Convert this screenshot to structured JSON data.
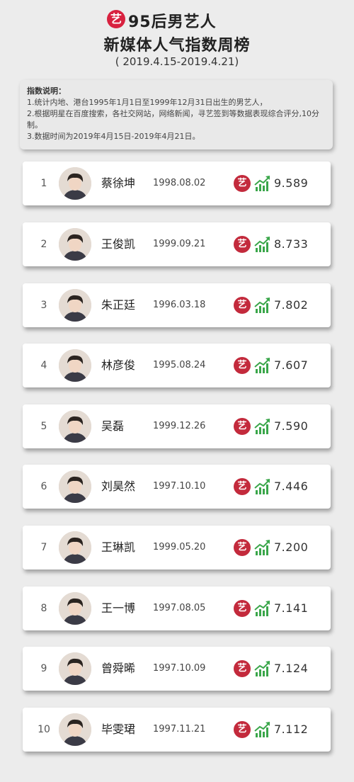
{
  "header": {
    "brand_badge": "艺",
    "title_line1": "95后男艺人",
    "title_line2": "新媒体人气指数周榜",
    "date_range": "( 2019.4.15-2019.4.21)"
  },
  "description": {
    "title": "指数说明：",
    "lines": [
      "1.统计内地、港台1995年1月1日至1999年12月31日出生的男艺人，",
      "2.根据明星在百度搜索，各社交网站，网络新闻，寻艺签到等数据表现综合评分,10分制。",
      "3.数据时间为2019年4月15日-2019年4月21日。"
    ]
  },
  "ranking": [
    {
      "rank": "1",
      "name": "蔡徐坤",
      "birth": "1998.08.02",
      "score": "9.589"
    },
    {
      "rank": "2",
      "name": "王俊凯",
      "birth": "1999.09.21",
      "score": "8.733"
    },
    {
      "rank": "3",
      "name": "朱正廷",
      "birth": "1996.03.18",
      "score": "7.802"
    },
    {
      "rank": "4",
      "name": "林彦俊",
      "birth": "1995.08.24",
      "score": "7.607"
    },
    {
      "rank": "5",
      "name": "吴磊",
      "birth": "1999.12.26",
      "score": "7.590"
    },
    {
      "rank": "6",
      "name": "刘昊然",
      "birth": "1997.10.10",
      "score": "7.446"
    },
    {
      "rank": "7",
      "name": "王琳凯",
      "birth": "1999.05.20",
      "score": "7.200"
    },
    {
      "rank": "8",
      "name": "王一博",
      "birth": "1997.08.05",
      "score": "7.141"
    },
    {
      "rank": "9",
      "name": "曾舜晞",
      "birth": "1997.10.09",
      "score": "7.124"
    },
    {
      "rank": "10",
      "name": "毕雯珺",
      "birth": "1997.11.21",
      "score": "7.112"
    }
  ],
  "row_icon_label": "艺",
  "icons": {
    "brand": "yi-logo-icon",
    "row_brand": "yi-logo-icon",
    "trend": "trend-chart-icon",
    "avatar": "person-avatar"
  },
  "colors": {
    "brand_red": "#d8213f",
    "trend_green": "#3aa64a",
    "background": "#ececec"
  }
}
